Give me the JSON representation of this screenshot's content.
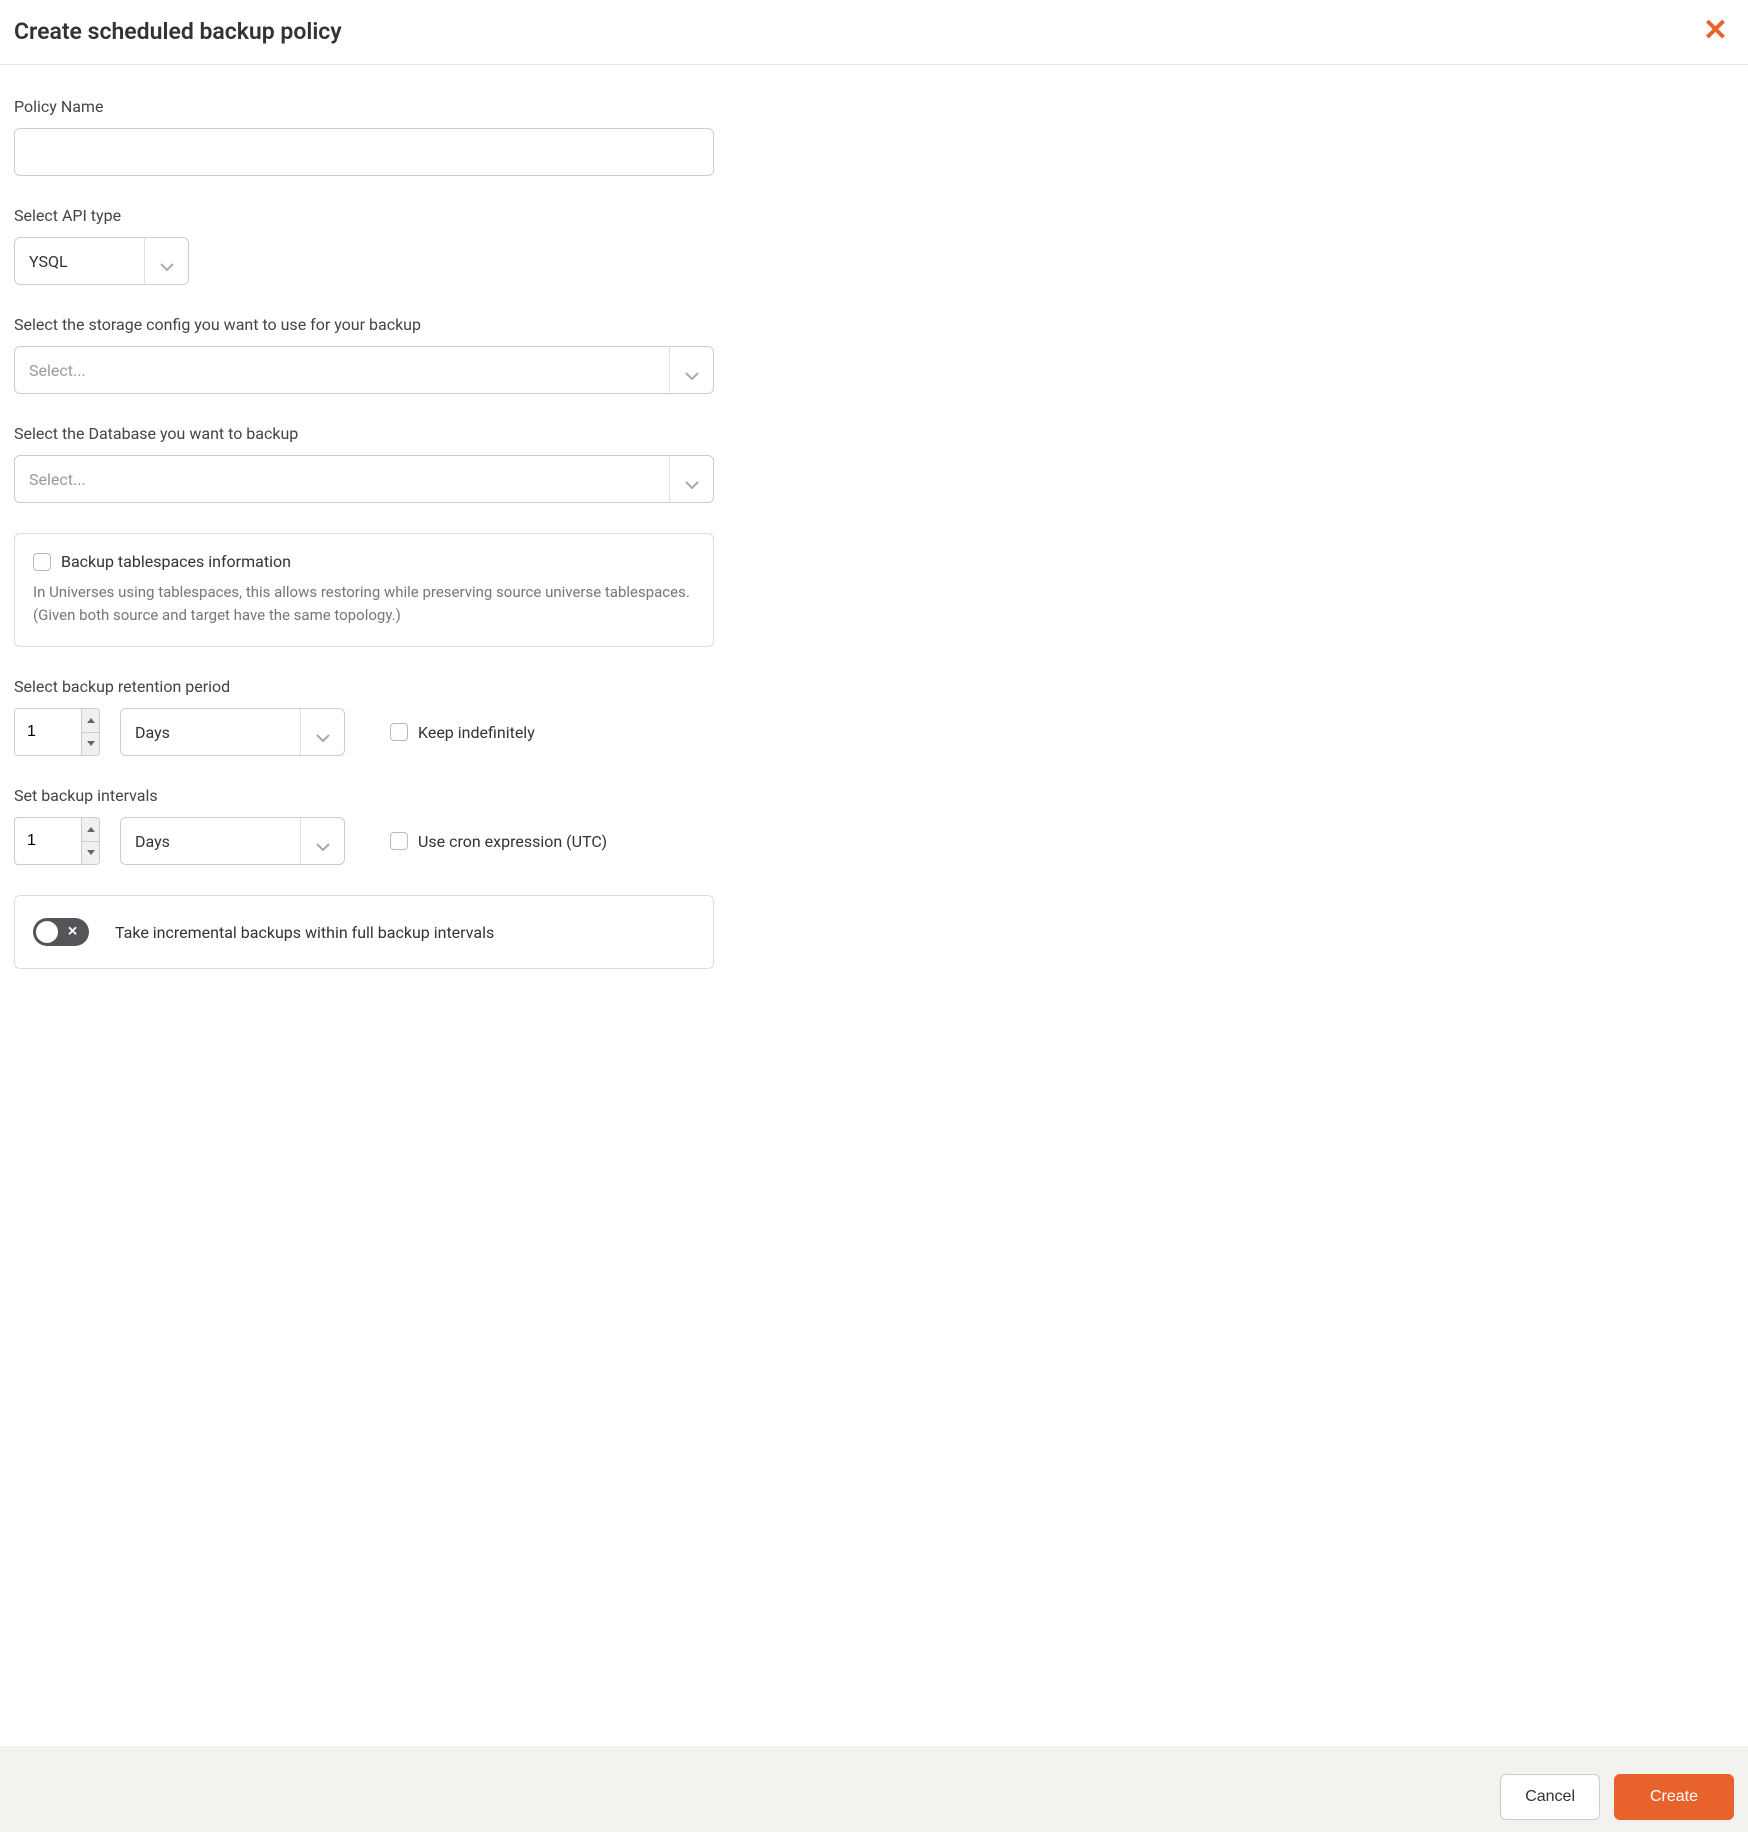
{
  "header": {
    "title": "Create scheduled backup policy"
  },
  "form": {
    "policy_name": {
      "label": "Policy Name",
      "value": ""
    },
    "api_type": {
      "label": "Select API type",
      "value": "YSQL"
    },
    "storage_config": {
      "label": "Select the storage config you want to use for your backup",
      "placeholder": "Select..."
    },
    "database": {
      "label": "Select the Database you want to backup",
      "placeholder": "Select..."
    },
    "tablespaces": {
      "label": "Backup tablespaces information",
      "helper": "In Universes using tablespaces, this allows restoring while preserving source universe tablespaces. (Given both source and target have the same topology.)",
      "checked": false
    },
    "retention": {
      "label": "Select backup retention period",
      "value": "1",
      "unit": "Days",
      "keep_indefinitely": {
        "label": "Keep indefinitely",
        "checked": false
      }
    },
    "intervals": {
      "label": "Set backup intervals",
      "value": "1",
      "unit": "Days",
      "cron": {
        "label": "Use cron expression (UTC)",
        "checked": false
      }
    },
    "incremental": {
      "label": "Take incremental backups within full backup intervals",
      "enabled": false
    }
  },
  "footer": {
    "cancel": "Cancel",
    "create": "Create"
  }
}
